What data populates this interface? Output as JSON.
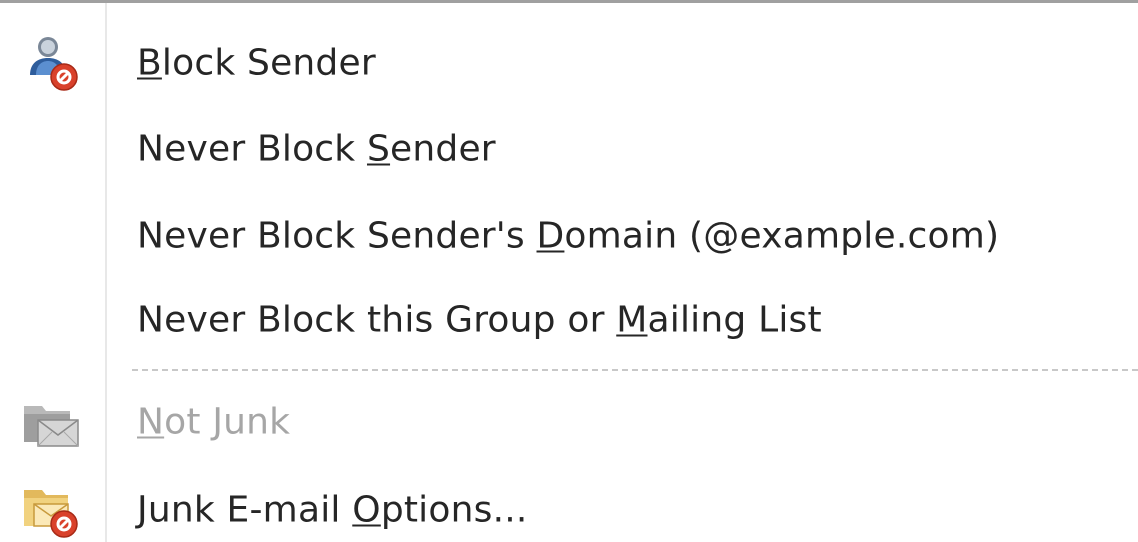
{
  "menu": {
    "items": [
      {
        "id": "block-sender",
        "pre": "",
        "acc": "B",
        "post": "lock Sender",
        "icon": "block-sender-icon",
        "enabled": true
      },
      {
        "id": "never-block-sender",
        "pre": "Never Block ",
        "acc": "S",
        "post": "ender",
        "icon": "",
        "enabled": true
      },
      {
        "id": "never-block-domain",
        "pre": "Never Block Sender's ",
        "acc": "D",
        "post": "omain (@example.com)",
        "icon": "",
        "enabled": true
      },
      {
        "id": "never-block-group",
        "pre": "Never Block this Group or ",
        "acc": "M",
        "post": "ailing List",
        "icon": "",
        "enabled": true
      },
      {
        "id": "not-junk",
        "pre": "",
        "acc": "N",
        "post": "ot Junk",
        "icon": "not-junk-icon",
        "enabled": false
      },
      {
        "id": "junk-options",
        "pre": "Junk E-mail ",
        "acc": "O",
        "post": "ptions...",
        "icon": "junk-options-icon",
        "enabled": true
      }
    ]
  },
  "colors": {
    "text": "#262626",
    "disabled_text": "#a6a6a6",
    "block_badge": "#d9412b"
  }
}
